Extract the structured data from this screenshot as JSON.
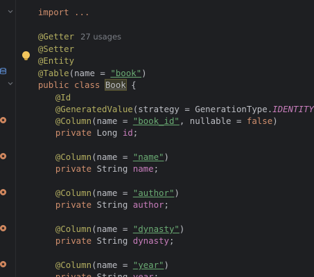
{
  "lines": {
    "l0": "import ...",
    "l1_ann": "@Getter",
    "l1_hint": "27 usages",
    "l2": "@Setter",
    "l3": "@Entity",
    "l4_ann_a": "@",
    "l4_ann_b": "Table",
    "l4_pre": "(name = ",
    "l4_str": "\"book\"",
    "l4_post": ")",
    "l5_kw": "public class ",
    "l5_cls": "Book",
    "l5_post": " {",
    "l6": "@Id",
    "l7_ann": "@GeneratedValue",
    "l7_pre": "(strategy = GenerationType.",
    "l7_const": "IDENTITY",
    "l7_post": ")",
    "l8_ann": "@Column",
    "l8_pre": "(name = ",
    "l8_str": "\"book_id\"",
    "l8_mid": ", nullable = ",
    "l8_kw": "false",
    "l8_post": ")",
    "l9_kw": "private ",
    "l9_type": "Long ",
    "l9_field": "id",
    "l9_post": ";",
    "l11_ann": "@Column",
    "l11_pre": "(name = ",
    "l11_str": "\"name\"",
    "l11_post": ")",
    "l12_kw": "private ",
    "l12_type": "String ",
    "l12_field": "name",
    "l12_post": ";",
    "l14_ann": "@Column",
    "l14_pre": "(name = ",
    "l14_str": "\"author\"",
    "l14_post": ")",
    "l15_kw": "private ",
    "l15_type": "String ",
    "l15_field": "author",
    "l15_post": ";",
    "l17_ann": "@Column",
    "l17_pre": "(name = ",
    "l17_str": "\"dynasty\"",
    "l17_post": ")",
    "l18_kw": "private ",
    "l18_type": "String ",
    "l18_field": "dynasty",
    "l18_post": ";",
    "l20_ann": "@Column",
    "l20_pre": "(name = ",
    "l20_str": "\"year\"",
    "l20_post": ")",
    "l21_kw": "private ",
    "l21_type": "String ",
    "l21_field": "year",
    "l21_post": ";"
  },
  "colors": {
    "background": "#1e1f22",
    "annotation": "#b3ae60",
    "keyword": "#cf8e6d",
    "string": "#6aab73",
    "field": "#c77dbb",
    "text": "#bcbec4",
    "hint": "#7a7e85"
  },
  "icons": {
    "intention_bulb": "lightbulb-icon",
    "datasource": "database-icon",
    "field_marker": "field-gutter-icon",
    "fold": "fold-chevron-icon"
  }
}
